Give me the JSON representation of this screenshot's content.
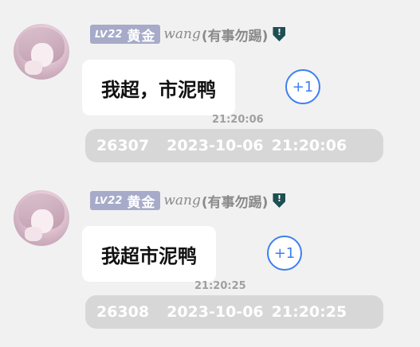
{
  "messages": [
    {
      "level_prefix": "LV",
      "level_num": "22",
      "level_tier": "黄金",
      "nickname": "wang",
      "nickname_suffix": "(有事勿踢)",
      "text": "我超，市泥鸭",
      "reaction": "+1",
      "time": "21:20:06",
      "message_id": "26307",
      "date": "2023-10-06",
      "datetime_time": "21:20:06"
    },
    {
      "level_prefix": "LV",
      "level_num": "22",
      "level_tier": "黄金",
      "nickname": "wang",
      "nickname_suffix": "(有事勿踢)",
      "text": "我超市泥鸭",
      "reaction": "+1",
      "time": "21:20:25",
      "message_id": "26308",
      "date": "2023-10-06",
      "datetime_time": "21:20:25"
    }
  ],
  "colors": {
    "background": "#f1f1f1",
    "level_badge": "#a7abc9",
    "reaction_accent": "#3d7ff0",
    "meta_bar": "#d7d7d7",
    "shield": "#1e4f52"
  },
  "icons": {
    "avatar": "anime-girl-avatar",
    "shield": "shield-icon"
  }
}
